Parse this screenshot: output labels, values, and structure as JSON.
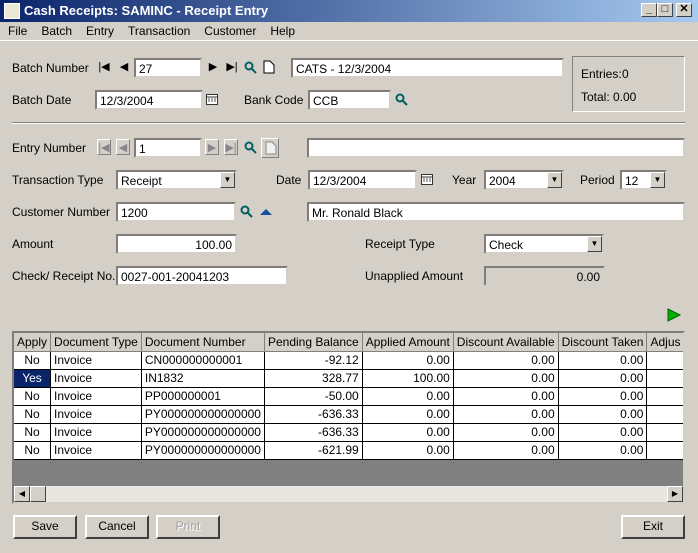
{
  "window": {
    "title": "Cash Receipts: SAMINC - Receipt Entry"
  },
  "menu": [
    "File",
    "Batch",
    "Entry",
    "Transaction",
    "Customer",
    "Help"
  ],
  "batch": {
    "number_label": "Batch Number",
    "number": "27",
    "description": "CATS - 12/3/2004",
    "date_label": "Batch Date",
    "date": "12/3/2004",
    "bank_label": "Bank Code",
    "bank": "CCB"
  },
  "summary": {
    "entries_label": "Entries:",
    "entries": "0",
    "total_label": "Total:",
    "total": "0.00"
  },
  "entry": {
    "number_label": "Entry Number",
    "number": "1",
    "description": "",
    "type_label": "Transaction Type",
    "type": "Receipt",
    "date_label": "Date",
    "date": "12/3/2004",
    "year_label": "Year",
    "year": "2004",
    "period_label": "Period",
    "period": "12",
    "customer_label": "Customer Number",
    "customer": "1200",
    "customer_name": "Mr. Ronald Black",
    "amount_label": "Amount",
    "amount": "100.00",
    "receipt_type_label": "Receipt Type",
    "receipt_type": "Check",
    "check_label": "Check/ Receipt No.",
    "check": "0027-001-20041203",
    "unapplied_label": "Unapplied Amount",
    "unapplied": "0.00"
  },
  "grid": {
    "columns": [
      "Apply",
      "Document Type",
      "Document Number",
      "Pending Balance",
      "Applied Amount",
      "Discount Available",
      "Discount Taken",
      "Adjus"
    ],
    "rows": [
      [
        "No",
        "Invoice",
        "CN000000000001",
        "-92.12",
        "0.00",
        "0.00",
        "0.00"
      ],
      [
        "Yes",
        "Invoice",
        "IN1832",
        "328.77",
        "100.00",
        "0.00",
        "0.00"
      ],
      [
        "No",
        "Invoice",
        "PP000000001",
        "-50.00",
        "0.00",
        "0.00",
        "0.00"
      ],
      [
        "No",
        "Invoice",
        "PY000000000000000",
        "-636.33",
        "0.00",
        "0.00",
        "0.00"
      ],
      [
        "No",
        "Invoice",
        "PY000000000000000",
        "-636.33",
        "0.00",
        "0.00",
        "0.00"
      ],
      [
        "No",
        "Invoice",
        "PY000000000000000",
        "-621.99",
        "0.00",
        "0.00",
        "0.00"
      ]
    ]
  },
  "buttons": {
    "save": "Save",
    "cancel": "Cancel",
    "print": "Print",
    "exit": "Exit"
  }
}
